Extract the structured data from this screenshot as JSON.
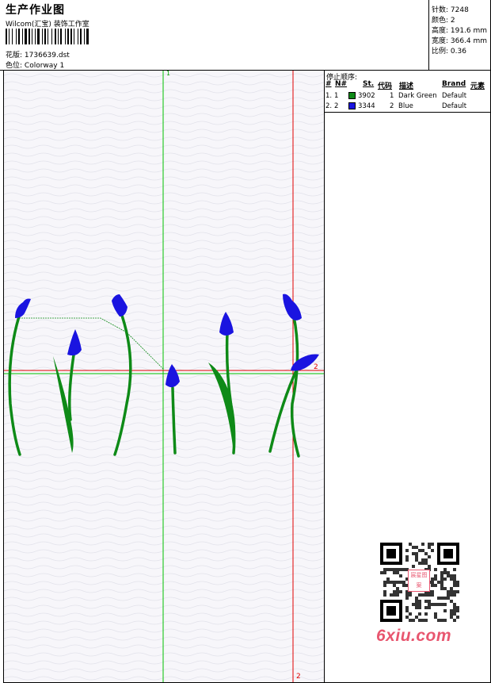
{
  "header": {
    "title": "生产作业图",
    "subtitle": "Wilcom(汇宝) 装饰工作室",
    "design_label": "花版:",
    "design_value": "1736639.dst",
    "colorway_label": "色位:",
    "colorway_value": "Colorway 1"
  },
  "stats": {
    "stitches": "针数: 7248",
    "colors": "颜色: 2",
    "height": "高度: 191.6 mm",
    "width": "宽度: 366.4 mm",
    "scale": "比例: 0.36"
  },
  "stop_sequence": {
    "title": "停止顺序:",
    "columns": [
      "#",
      "N#",
      "St.",
      "代码",
      "描述",
      "Brand",
      "元素"
    ],
    "rows": [
      {
        "index": "1.",
        "n": "1",
        "st": "3902",
        "code": "1",
        "desc": "Dark Green",
        "brand": "Default",
        "color": "#0e8a17"
      },
      {
        "index": "2.",
        "n": "2",
        "st": "3344",
        "code": "2",
        "desc": "Blue",
        "brand": "Default",
        "color": "#1a14e0"
      }
    ]
  },
  "markers": {
    "green_top": "1",
    "red_right": "2",
    "red_bottom": "2"
  },
  "watermark": {
    "site": "6xiu.com",
    "seal": "宸星图案"
  },
  "colors": {
    "thread_green": "#0e8a17",
    "thread_blue": "#1a14e0",
    "guide_green": "#00c000",
    "guide_red": "#e00000"
  }
}
